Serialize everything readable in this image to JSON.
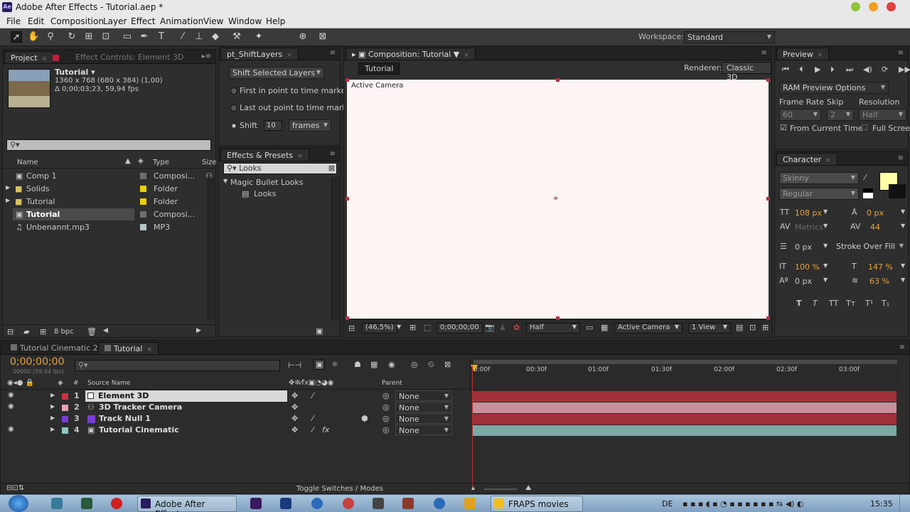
{
  "window": {
    "title": "Adobe After Effects - Tutorial.aep *",
    "logo": "Ae"
  },
  "menu": [
    "File",
    "Edit",
    "Composition",
    "Layer",
    "Effect",
    "Animation",
    "View",
    "Window",
    "Help"
  ],
  "toolbar": {
    "workspace_label": "Workspace:",
    "workspace_value": "Standard"
  },
  "project": {
    "tab_project": "Project",
    "tab_effect_controls": "Effect Controls: Element 3D",
    "comp_name": "Tutorial ▾",
    "comp_info_1": "1360 x 768  (680 x 384) (1,00)",
    "comp_info_2": "Δ 0;00;03;23, 59,94 fps",
    "col_name": "Name",
    "col_type": "Type",
    "col_size": "Size",
    "items": [
      {
        "name": "Comp 1",
        "type": "Composi...",
        "color": "#6e6e6e"
      },
      {
        "name": "Solids",
        "type": "Folder",
        "color": "#e8d200"
      },
      {
        "name": "Tutorial",
        "type": "Folder",
        "color": "#e8d200"
      },
      {
        "name": "Tutorial",
        "type": "Composi...",
        "color": "#6e6e6e"
      },
      {
        "name": "Unbenannt.mp3",
        "type": "MP3",
        "color": "#b4c4c4"
      }
    ],
    "bpc": "8 bpc"
  },
  "shift_layers": {
    "tab": "pt_ShiftLayers",
    "mode": "Shift Selected Layers",
    "opt1": "First in point to time marker",
    "opt2": "Last out point to time marker",
    "opt3": "Shift",
    "shift_value": "10",
    "unit": "frames"
  },
  "effects_presets": {
    "tab": "Effects & Presets",
    "search": "Looks",
    "group": "Magic Bullet Looks",
    "item": "Looks"
  },
  "composition": {
    "tab": "Composition: Tutorial",
    "subtab": "Tutorial",
    "renderer_label": "Renderer:",
    "renderer_value": "Classic 3D",
    "camera_label": "Active Camera",
    "zoom": "(46,5%)",
    "timecode": "0;00;00;00",
    "resolution": "Half",
    "view": "Active Camera",
    "layout": "1 View"
  },
  "preview": {
    "tab": "Preview",
    "ram_options": "RAM Preview Options",
    "frame_rate_label": "Frame Rate",
    "skip_label": "Skip",
    "resolution_label": "Resolution",
    "frame_rate": "60",
    "skip": "2",
    "resolution": "Half",
    "from_current": "From Current Time",
    "full_screen": "Full Screen"
  },
  "character": {
    "tab": "Character",
    "font": "Skinny",
    "style": "Regular",
    "size": "108 px",
    "leading": "0 px",
    "kerning": "Metrics",
    "tracking": "44",
    "stroke_width": "0 px",
    "stroke_mode": "Stroke Over Fill",
    "v_scale": "100 %",
    "h_scale": "147 %",
    "baseline": "0 px",
    "tsume": "63 %",
    "fill_color": "#ffffa8"
  },
  "timeline": {
    "tab1": "Tutorial Cinematic 2",
    "tab2": "Tutorial",
    "timecode": "0;00;00;00",
    "timecode_sub": "00000 (59.94 fps)",
    "col_source": "Source Name",
    "col_parent": "Parent",
    "ruler": [
      "0:00f",
      "00:30f",
      "01:00f",
      "01:30f",
      "02:00f",
      "02:30f",
      "03:00f"
    ],
    "layers": [
      {
        "num": "1",
        "name": "Element 3D",
        "parent": "None",
        "color": "#c8323c",
        "bar": "#a0303a"
      },
      {
        "num": "2",
        "name": "3D Tracker Camera",
        "parent": "None",
        "color": "#e8a0b0",
        "bar": "#c8909c"
      },
      {
        "num": "3",
        "name": "Track Null 1",
        "parent": "None",
        "color": "#7a3cd6",
        "bar": "#a0303a"
      },
      {
        "num": "4",
        "name": "Tutorial Cinematic",
        "parent": "None",
        "color": "#8cc8c0",
        "bar": "#7ca8a4"
      }
    ],
    "toggle": "Toggle Switches / Modes"
  },
  "taskbar": {
    "ae_label": "Adobe After Effects - ...",
    "fraps_label": "FRAPS movies",
    "lang": "DE",
    "clock": "15:35"
  }
}
